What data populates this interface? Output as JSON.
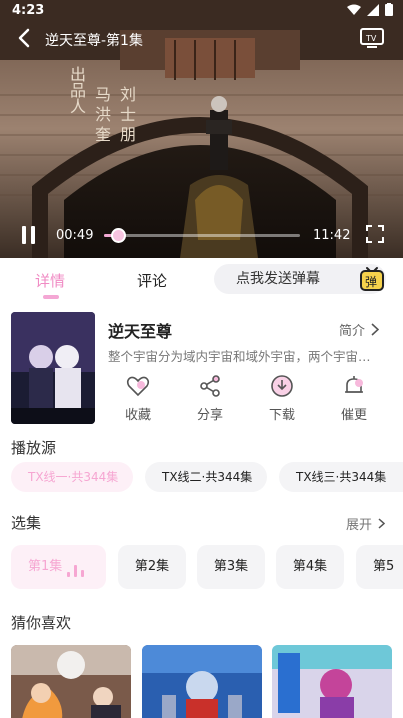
{
  "status": {
    "time": "4:23"
  },
  "player": {
    "title": "逆天至尊-第1集",
    "poster_text": "出品人 马洪奎 刘士朋",
    "current_time": "00:49",
    "total_time": "11:42",
    "progress": 0.07
  },
  "tabs": {
    "details": "详情",
    "comments": "评论"
  },
  "danmu": {
    "placeholder": "点我发送弹幕",
    "button": "弹"
  },
  "show": {
    "title": "逆天至尊",
    "intro_label": "简介",
    "description": "整个宇宙分为域内宇宙和域外宇宙，两个宇宙…",
    "actions": [
      {
        "label": "收藏",
        "icon": "heart-icon"
      },
      {
        "label": "分享",
        "icon": "share-icon"
      },
      {
        "label": "下载",
        "icon": "download-icon"
      },
      {
        "label": "催更",
        "icon": "bell-icon"
      }
    ]
  },
  "sources": {
    "title": "播放源",
    "items": [
      "TX线一·共344集",
      "TX线二·共344集",
      "TX线三·共344集"
    ]
  },
  "episodes": {
    "title": "选集",
    "more_label": "展开",
    "items": [
      "第1集",
      "第2集",
      "第3集",
      "第4集",
      "第5"
    ]
  },
  "recommend": {
    "title": "猜你喜欢"
  },
  "colors": {
    "accent": "#f08bc4",
    "accent_light": "#fdf0f7"
  }
}
